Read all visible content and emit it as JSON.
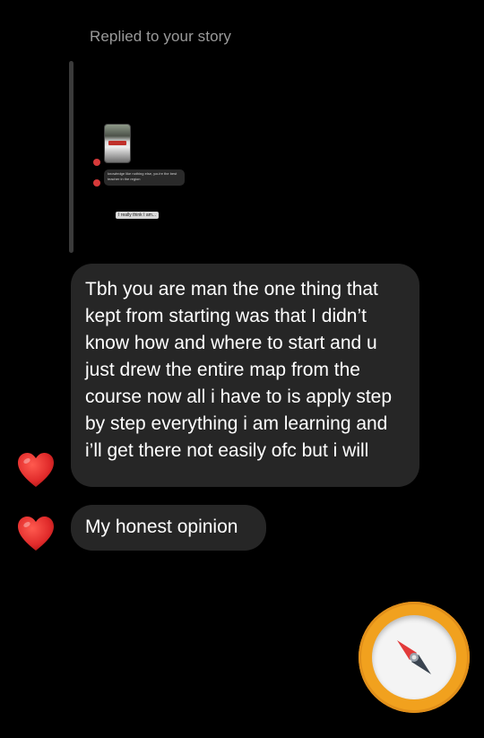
{
  "thread": {
    "replied_label": "Replied to your story"
  },
  "story_preview": {
    "comment_text": "knowledge like nothing else, you're the best teacher in the region",
    "reply_text": "I really think I am..."
  },
  "messages": [
    {
      "text": "Tbh you are man the one thing that kept from starting was that I didn’t know how and where to start and u just drew the entire map from the course now all i have to is apply step by step everything i am learning and i’ll get there not easily ofc but i will",
      "reaction_icon": "red-heart-icon"
    },
    {
      "text": "My honest opinion",
      "reaction_icon": "red-heart-icon"
    }
  ],
  "colors": {
    "background": "#000000",
    "bubble": "#262626",
    "muted_text": "#9a9a9a",
    "heart": "#e02a2a",
    "compass_ring": "#f1a11e"
  },
  "floating_action": {
    "icon": "compass-icon"
  }
}
